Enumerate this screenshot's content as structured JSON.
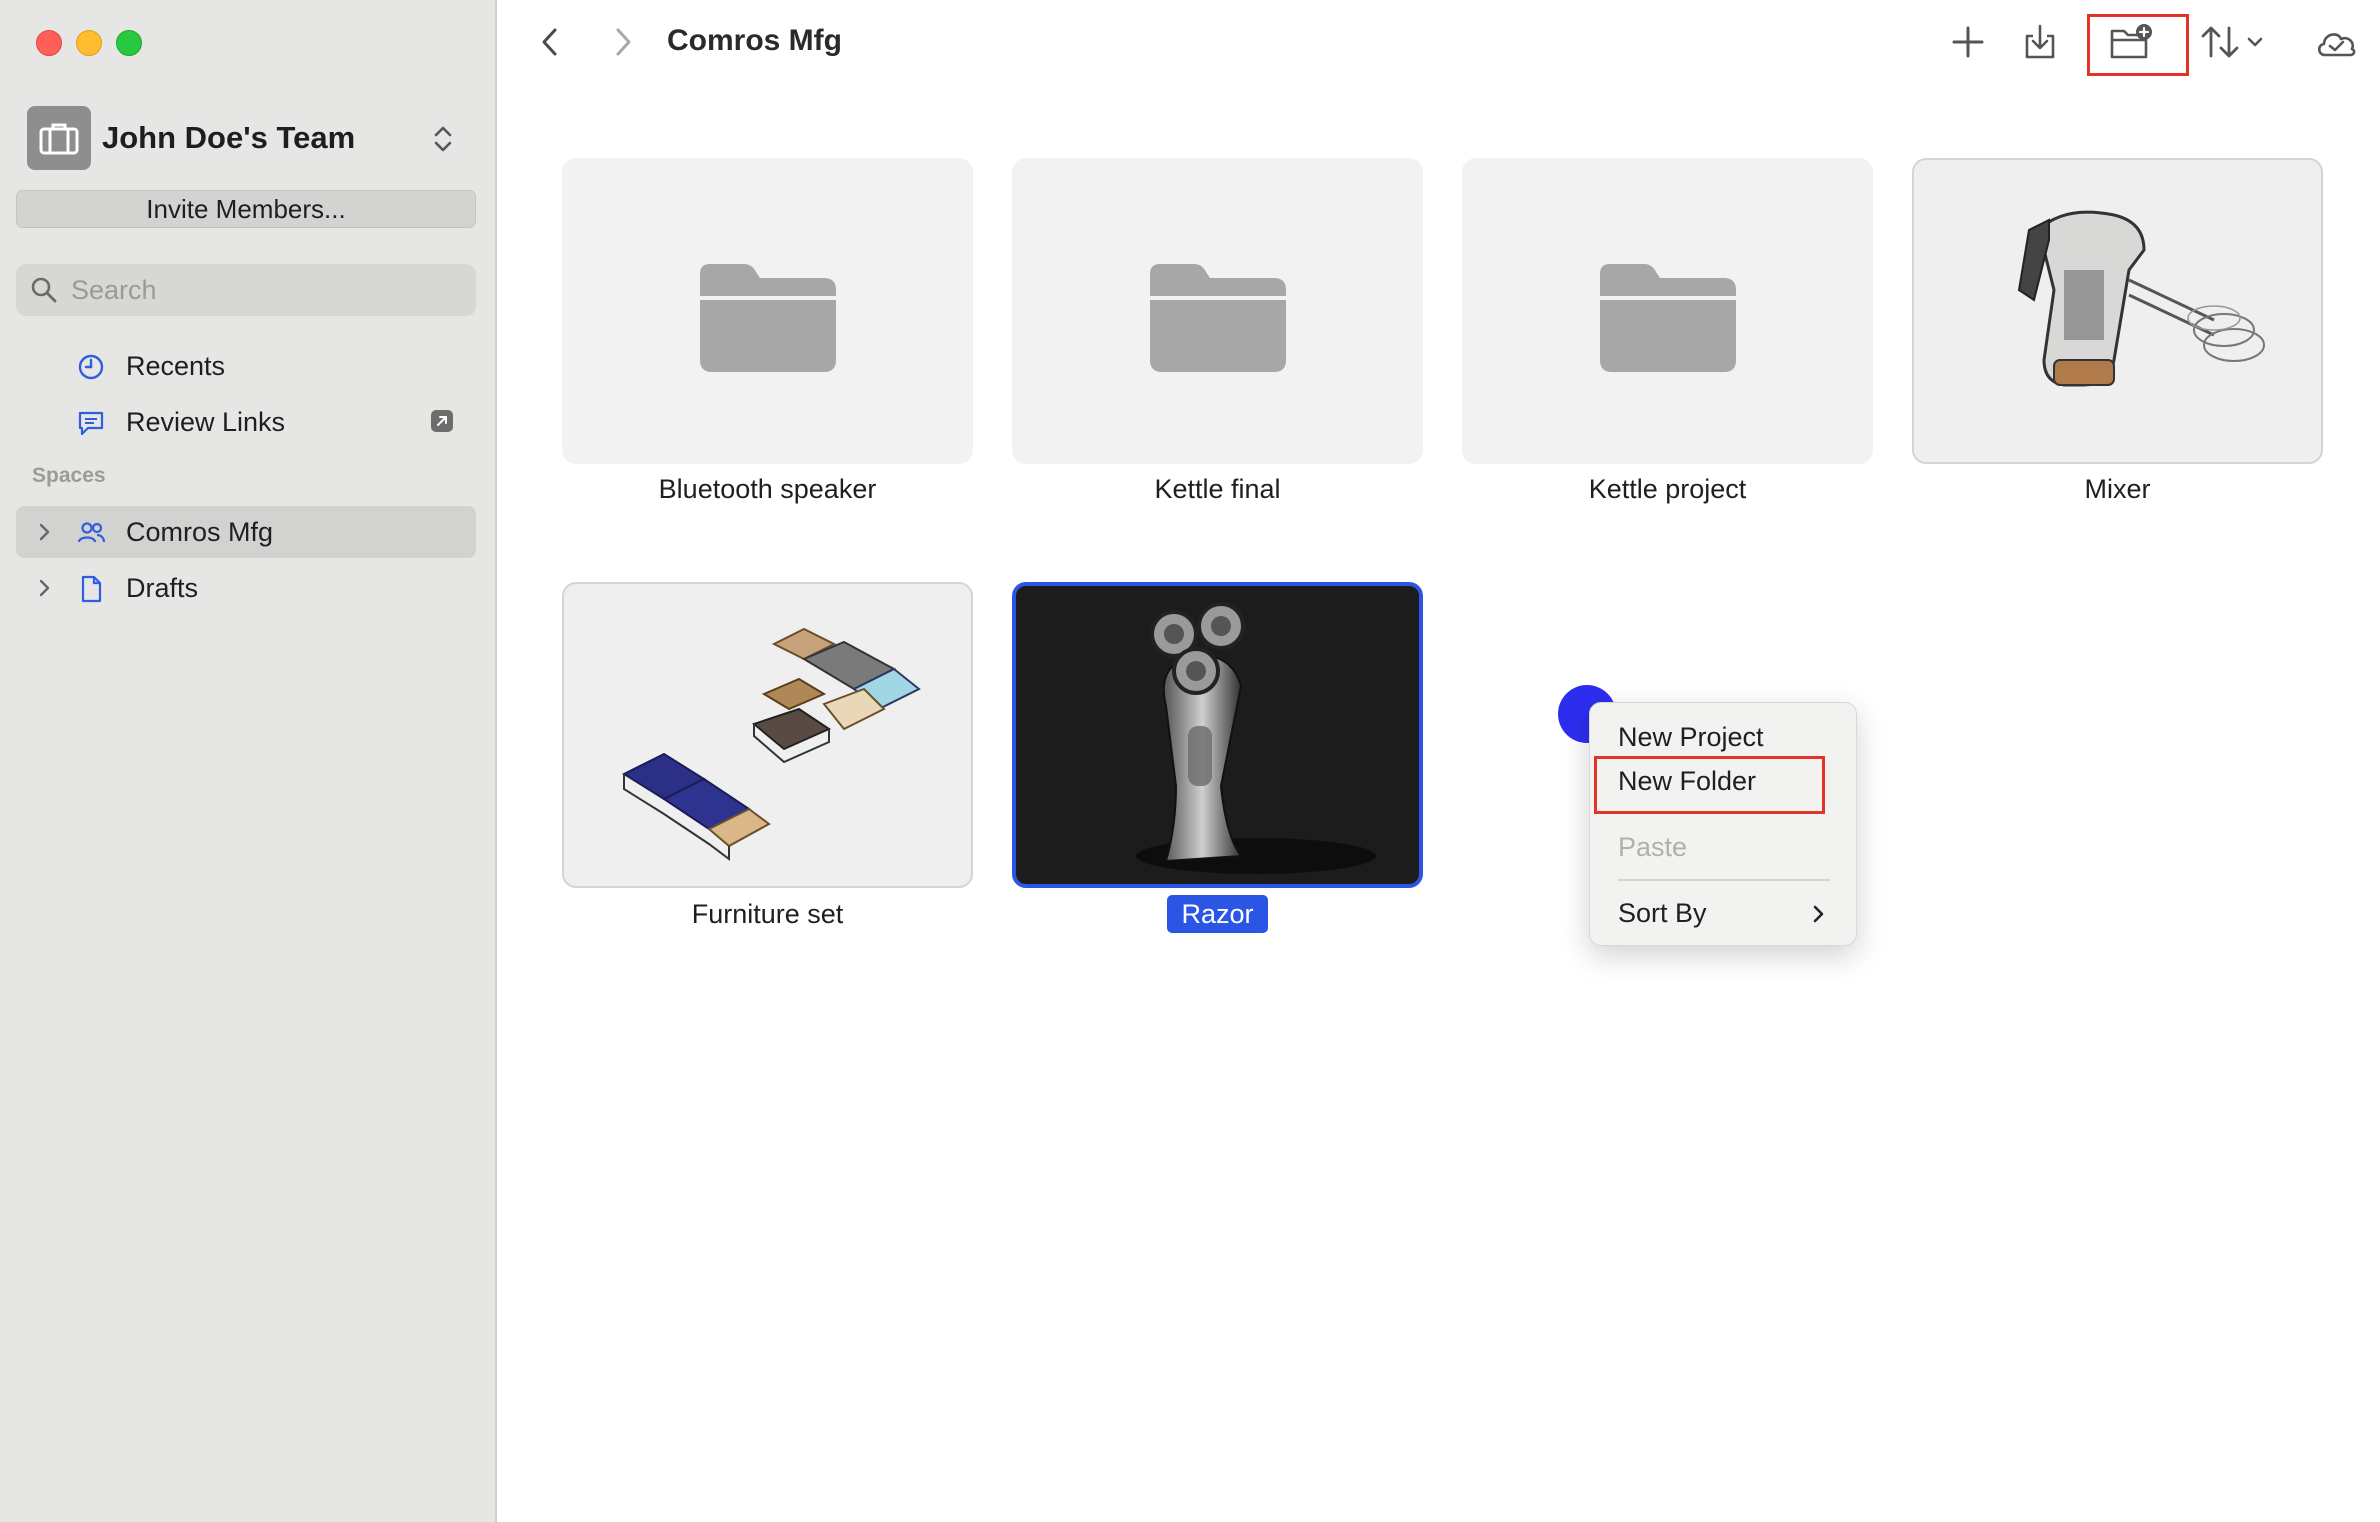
{
  "sidebar": {
    "team_name": "John Doe's Team",
    "invite_label": "Invite Members...",
    "search_placeholder": "Search",
    "nav": [
      {
        "label": "Recents",
        "icon": "clock-icon"
      },
      {
        "label": "Review Links",
        "icon": "chat-bubble-icon"
      }
    ],
    "spaces_label": "Spaces",
    "spaces": [
      {
        "label": "Comros Mfg",
        "icon": "people-icon",
        "selected": true
      },
      {
        "label": "Drafts",
        "icon": "document-icon",
        "selected": false
      }
    ]
  },
  "toolbar": {
    "title": "Comros Mfg",
    "buttons": [
      "back-icon",
      "forward-icon",
      "plus-icon",
      "import-icon",
      "new-folder-icon",
      "sort-icon",
      "chevron-down-icon",
      "cloud-check-icon"
    ]
  },
  "items": [
    {
      "label": "Bluetooth speaker",
      "kind": "folder"
    },
    {
      "label": "Kettle final",
      "kind": "folder"
    },
    {
      "label": "Kettle project",
      "kind": "folder"
    },
    {
      "label": "Mixer",
      "kind": "model"
    },
    {
      "label": "Furniture set",
      "kind": "model"
    },
    {
      "label": "Razor",
      "kind": "model",
      "selected": true
    }
  ],
  "context_menu": {
    "new_project": "New Project",
    "new_folder": "New Folder",
    "paste": "Paste",
    "sort_by": "Sort By"
  },
  "colors": {
    "accent": "#2a55e5",
    "highlight": "#e53228",
    "sidebar_bg": "#e6e6e4",
    "cursor": "#2d2df0"
  }
}
